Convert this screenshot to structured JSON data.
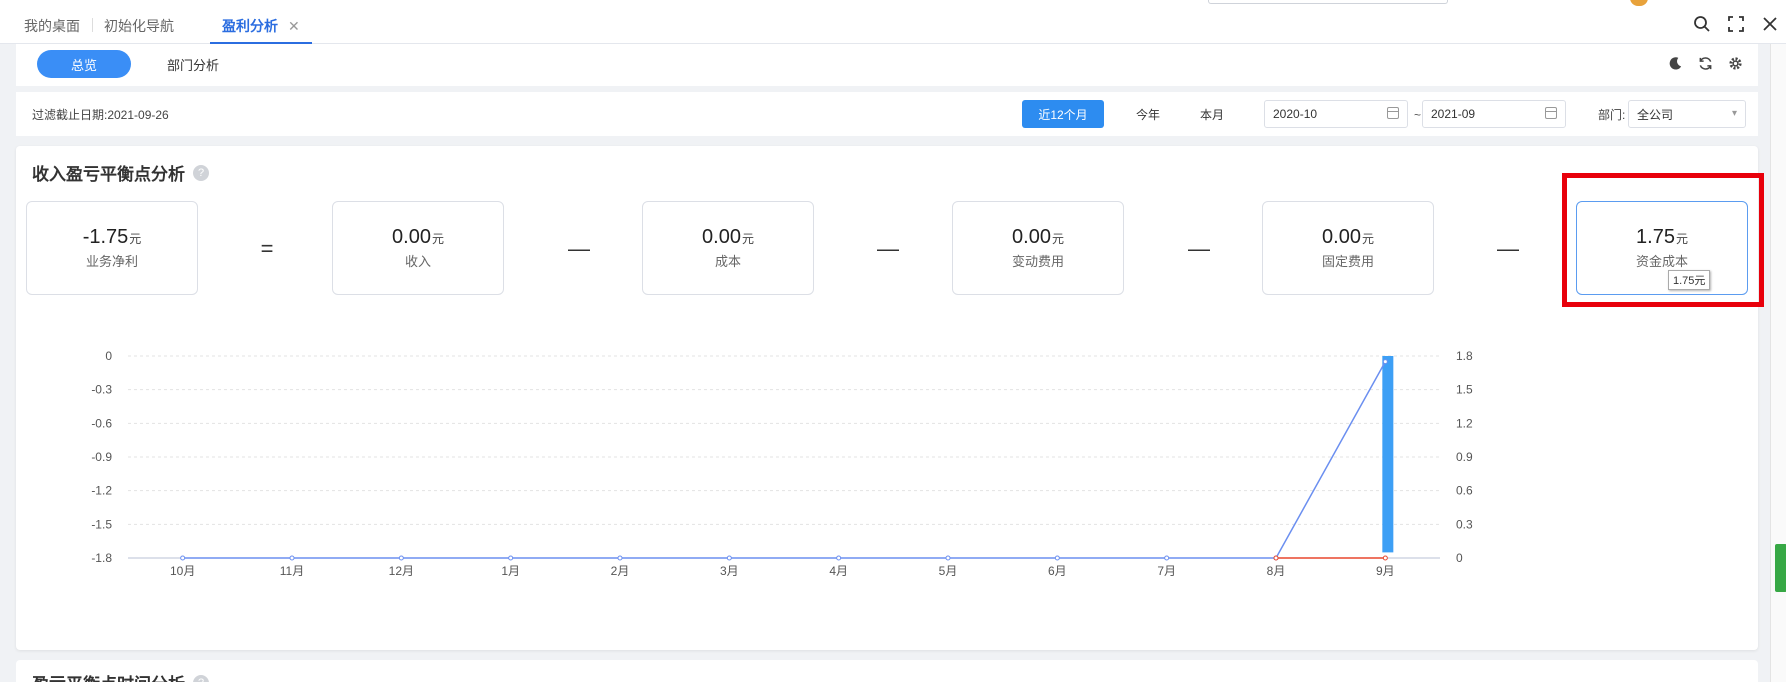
{
  "tabs": [
    {
      "label": "我的桌面"
    },
    {
      "label": "初始化导航"
    },
    {
      "label": "盈利分析",
      "close": "✕"
    }
  ],
  "window_icons": [
    "search-icon",
    "fullscreen-icon",
    "close-icon"
  ],
  "subnav": {
    "overview": "总览",
    "dept": "部门分析"
  },
  "filter": {
    "date_label": "过滤截止日期:2021-09-26",
    "quick": [
      "近12个月",
      "今年",
      "本月"
    ],
    "start": "2020-10",
    "tilde": "~",
    "end": "2021-09",
    "dept_label": "部门:",
    "dept_value": "全公司"
  },
  "section": {
    "title": "收入盈亏平衡点分析",
    "help": "?"
  },
  "metrics": [
    {
      "value": "-1.75",
      "unit": "元",
      "label": "业务净利"
    },
    {
      "value": "0.00",
      "unit": "元",
      "label": "收入"
    },
    {
      "value": "0.00",
      "unit": "元",
      "label": "成本"
    },
    {
      "value": "0.00",
      "unit": "元",
      "label": "变动费用"
    },
    {
      "value": "0.00",
      "unit": "元",
      "label": "固定费用"
    },
    {
      "value": "1.75",
      "unit": "元",
      "label": "资金成本"
    }
  ],
  "operators": [
    "=",
    "—",
    "—",
    "—",
    "—"
  ],
  "tooltip": "1.75元",
  "chart_data": {
    "type": "bar",
    "categories": [
      "10月",
      "11月",
      "12月",
      "1月",
      "2月",
      "3月",
      "4月",
      "5月",
      "6月",
      "7月",
      "8月",
      "9月"
    ],
    "y_left": {
      "ticks": [
        "0",
        "-0.3",
        "-0.6",
        "-0.9",
        "-1.2",
        "-1.5",
        "-1.8"
      ],
      "range": [
        -1.8,
        0
      ]
    },
    "y_right": {
      "ticks": [
        "1.8",
        "1.5",
        "1.2",
        "0.9",
        "0.6",
        "0.3",
        "0"
      ],
      "range": [
        0,
        1.8
      ]
    },
    "series": [
      {
        "type": "bar",
        "axis": "left",
        "color": "#3d9ff5",
        "values": [
          0,
          0,
          0,
          0,
          0,
          0,
          0,
          0,
          0,
          0,
          0,
          -1.75
        ]
      },
      {
        "type": "line",
        "axis": "right",
        "color": "#6b8ff0",
        "values": [
          0,
          0,
          0,
          0,
          0,
          0,
          0,
          0,
          0,
          0,
          0,
          1.75
        ]
      },
      {
        "type": "line",
        "axis": "right",
        "color": "#e8472d",
        "values": [
          null,
          null,
          null,
          null,
          null,
          null,
          null,
          null,
          null,
          null,
          0,
          0
        ]
      }
    ],
    "grid": true
  },
  "section2": {
    "title": "盈亏平衡点时间分析",
    "help": "?"
  }
}
